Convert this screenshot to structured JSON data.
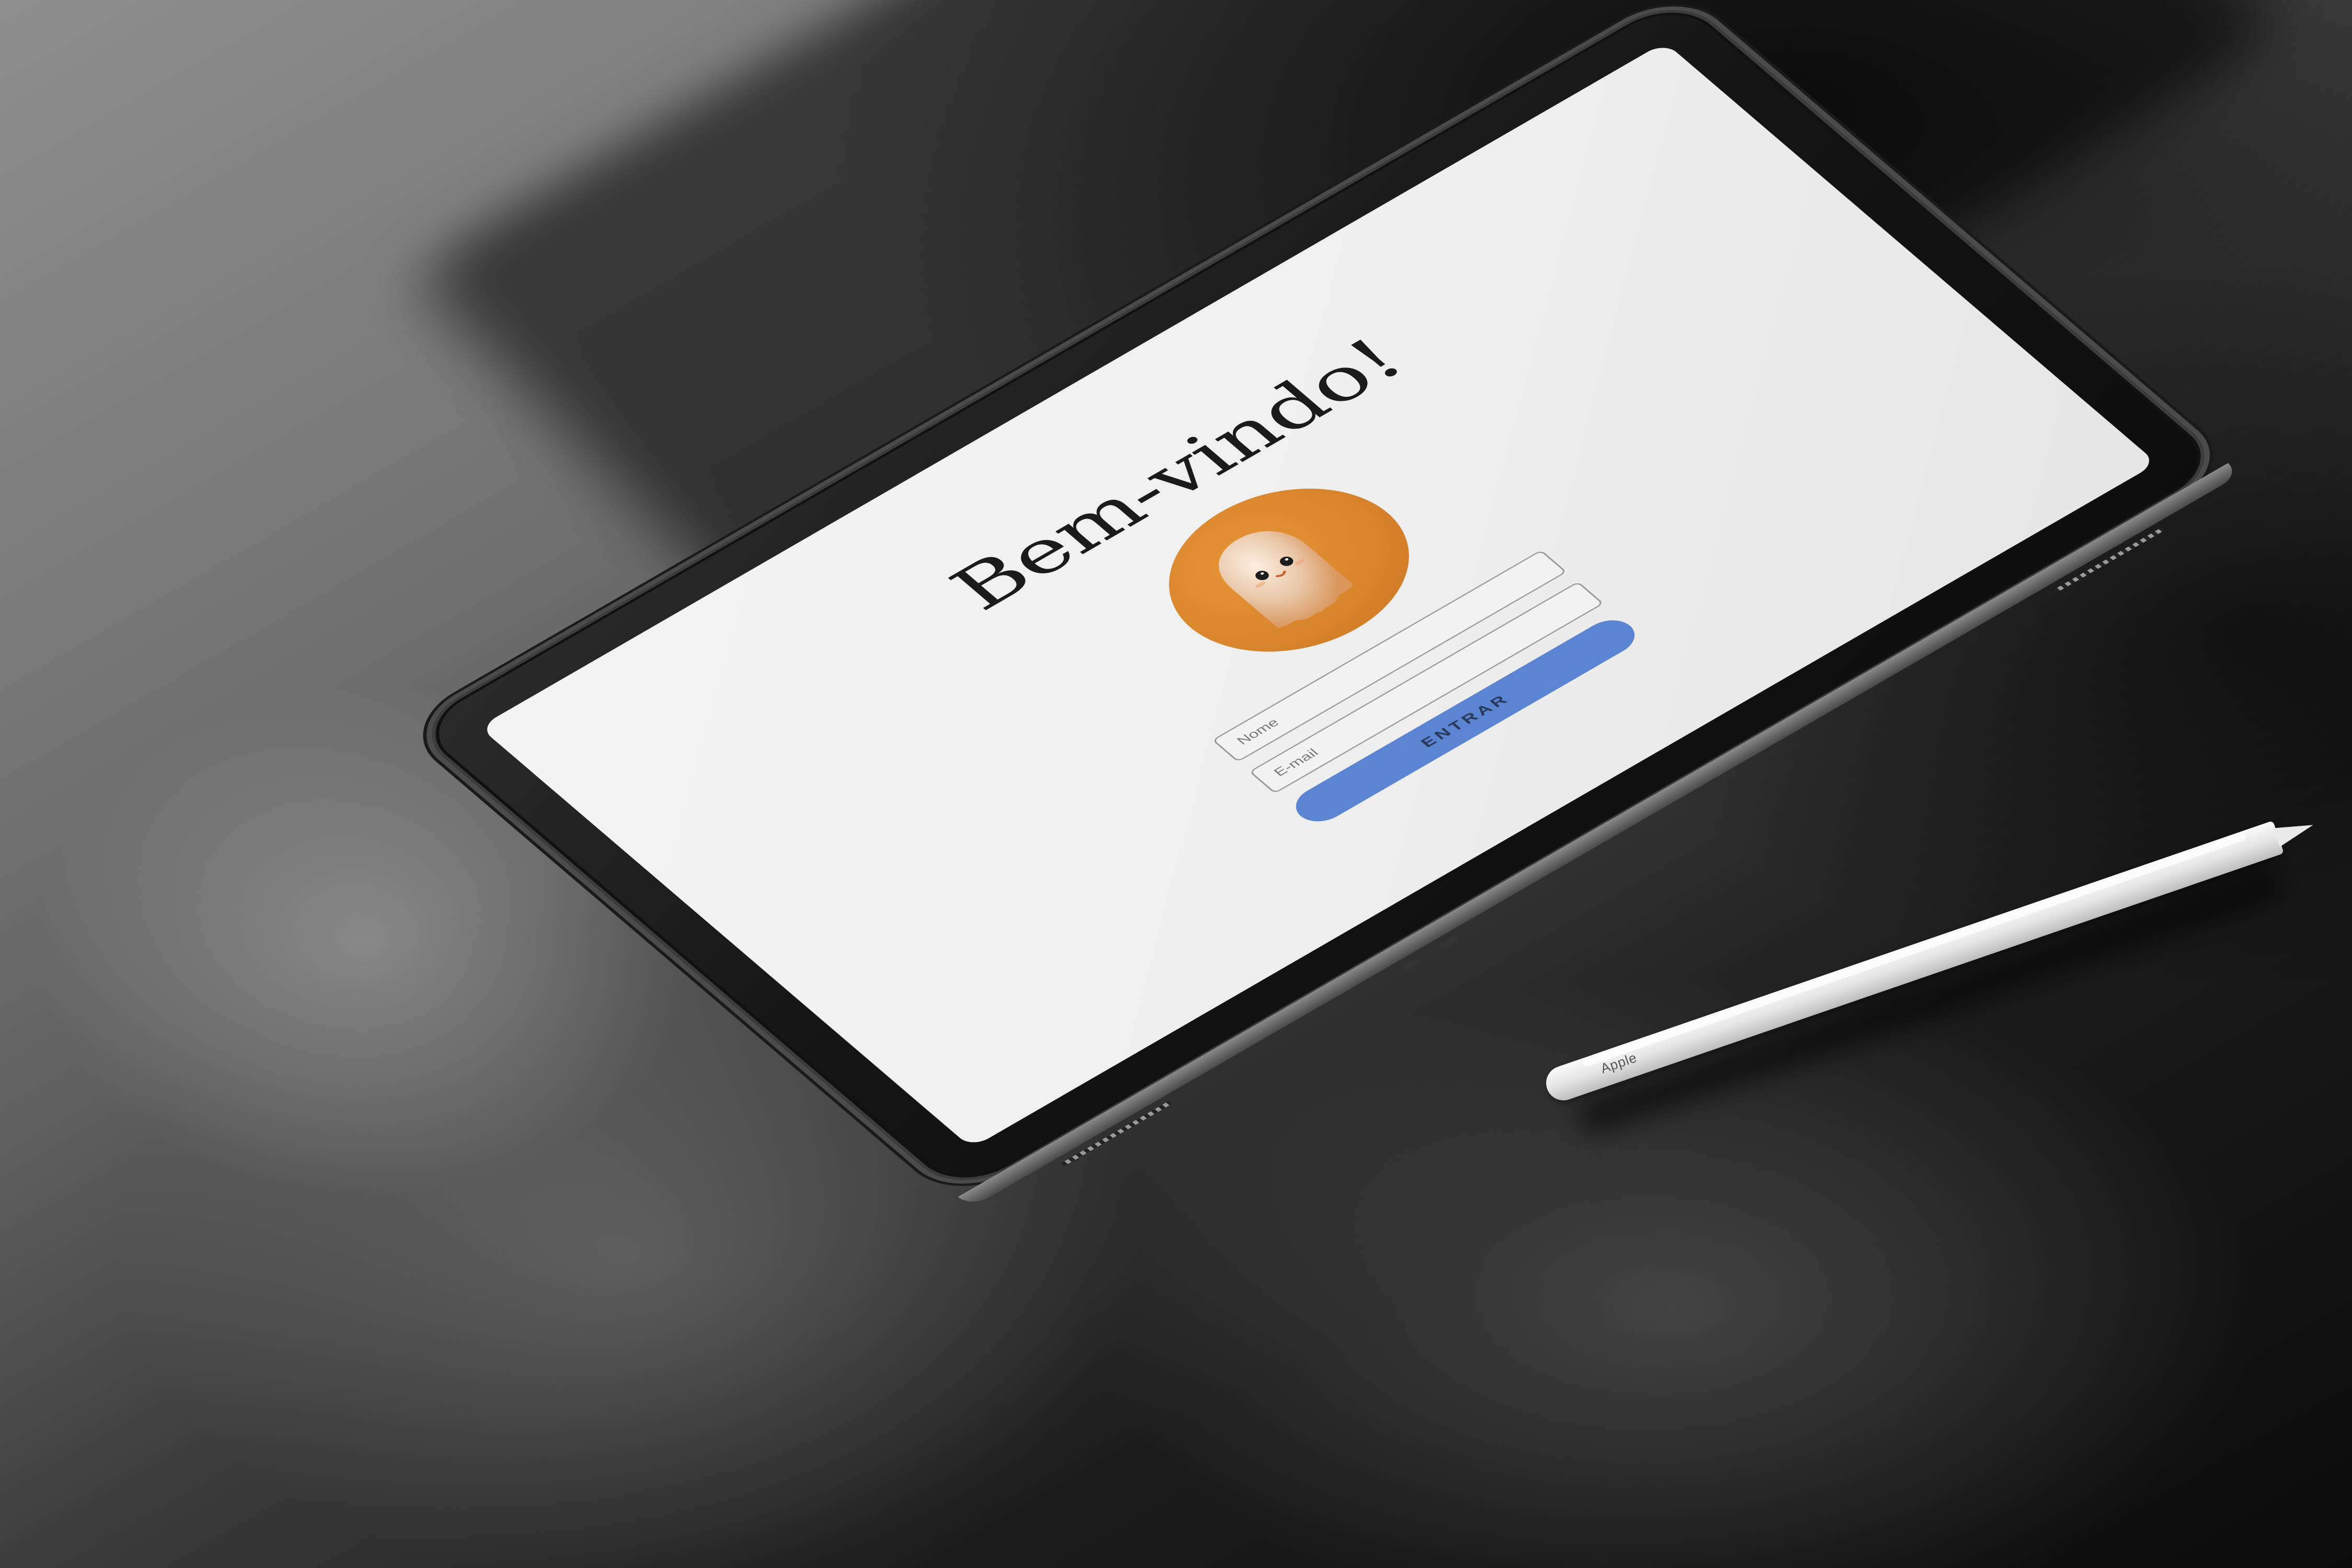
{
  "screen": {
    "title": "Bem-vindo!",
    "avatar": {
      "background_color": "#d8842c",
      "icon": "ghost-icon"
    },
    "form": {
      "name_placeholder": "Nome",
      "email_placeholder": "E-mail",
      "submit_label": "ENTRAR",
      "submit_color": "#5b84d2"
    }
  },
  "stylus": {
    "brand": "Apple"
  }
}
